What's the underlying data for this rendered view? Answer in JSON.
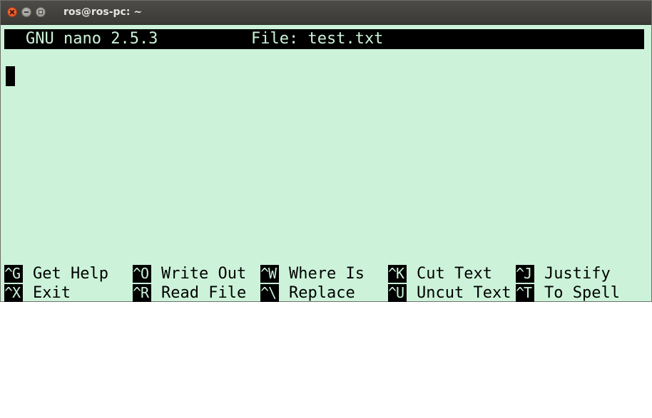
{
  "window": {
    "title": "ros@ros-pc: ~",
    "buttons": [
      "close-icon",
      "minimize-icon",
      "maximize-icon"
    ]
  },
  "nano": {
    "version": "GNU nano 2.5.3",
    "file": "File: test.txt"
  },
  "shortcuts": {
    "row1": [
      {
        "key": "^G",
        "label": "Get Help"
      },
      {
        "key": "^O",
        "label": "Write Out"
      },
      {
        "key": "^W",
        "label": "Where Is"
      },
      {
        "key": "^K",
        "label": "Cut Text"
      },
      {
        "key": "^J",
        "label": "Justify"
      }
    ],
    "row2": [
      {
        "key": "^X",
        "label": "Exit"
      },
      {
        "key": "^R",
        "label": "Read File"
      },
      {
        "key": "^\\",
        "label": "Replace"
      },
      {
        "key": "^U",
        "label": "Uncut Text"
      },
      {
        "key": "^T",
        "label": "To Spell"
      }
    ]
  },
  "colors": {
    "terminal_background": "#ccf3d9",
    "terminal_foreground": "#000000",
    "titlebar": "#3b3a37",
    "close_button": "#df4a16"
  }
}
